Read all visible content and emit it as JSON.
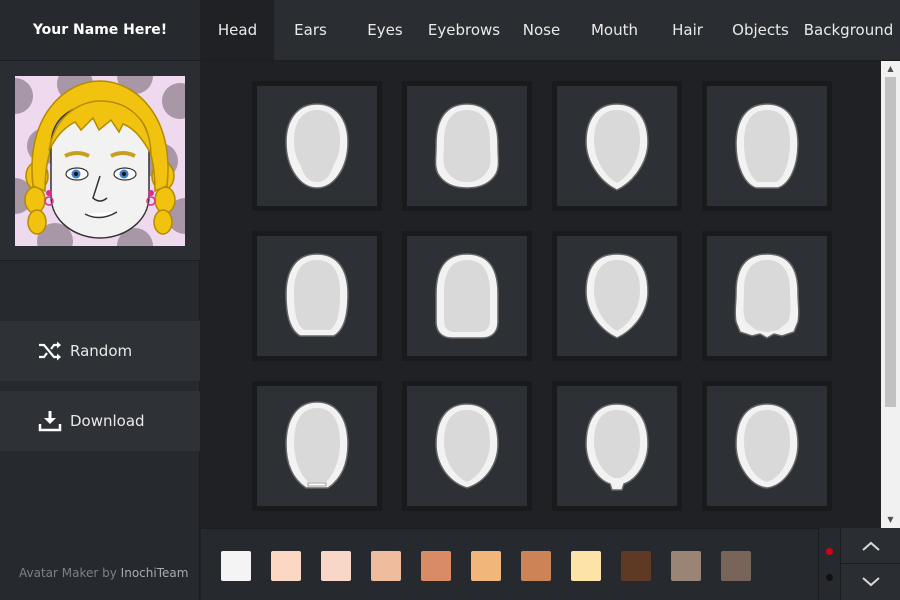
{
  "profile": {
    "name": "Your Name Here!"
  },
  "tabs": [
    {
      "label": "Head",
      "active": true
    },
    {
      "label": "Ears",
      "active": false
    },
    {
      "label": "Eyes",
      "active": false
    },
    {
      "label": "Eyebrows",
      "active": false
    },
    {
      "label": "Nose",
      "active": false
    },
    {
      "label": "Mouth",
      "active": false
    },
    {
      "label": "Hair",
      "active": false
    },
    {
      "label": "Objects",
      "active": false
    },
    {
      "label": "Background",
      "active": false
    }
  ],
  "actions": {
    "random_label": "Random",
    "download_label": "Download"
  },
  "footer": {
    "credit_prefix": "Avatar Maker by ",
    "credit_team": "InochiTeam"
  },
  "head_shapes": [
    {
      "icon": "head-shape-oval-icon"
    },
    {
      "icon": "head-shape-wide-icon"
    },
    {
      "icon": "head-shape-pointed-icon"
    },
    {
      "icon": "head-shape-rounded-icon"
    },
    {
      "icon": "head-shape-square-icon"
    },
    {
      "icon": "head-shape-block-icon"
    },
    {
      "icon": "head-shape-heart-icon"
    },
    {
      "icon": "head-shape-jagged-icon"
    },
    {
      "icon": "head-shape-long-icon"
    },
    {
      "icon": "head-shape-soft-icon"
    },
    {
      "icon": "head-shape-chin-icon"
    },
    {
      "icon": "head-shape-egg-icon"
    }
  ],
  "skin_colors": [
    "#f4f4f4",
    "#fcd7c4",
    "#f8d6c8",
    "#efbd9d",
    "#d98b66",
    "#f0b67a",
    "#cc8456",
    "#fde3a8",
    "#5e3a24",
    "#9a8476",
    "#786459"
  ],
  "pager_dots": [
    {
      "active": true,
      "color": "#d0021b"
    },
    {
      "active": false,
      "color": "#111111"
    }
  ],
  "colors": {
    "accent_red": "#d0021b",
    "hair": "#f1c30f",
    "skin": "#f2f2f2"
  }
}
